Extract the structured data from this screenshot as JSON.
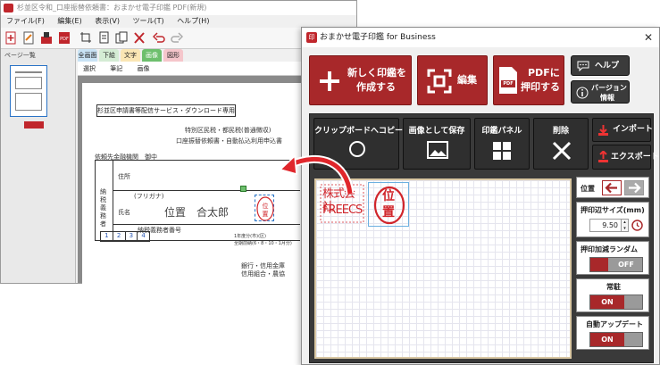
{
  "background_app": {
    "title": "杉並区令和_口座振替依頼書：おまかせ電子印鑑 PDF(新規)",
    "menu": [
      "ファイル(F)",
      "編集(E)",
      "表示(V)",
      "ツール(T)",
      "ヘルプ(H)"
    ],
    "page_panel_title": "ページ一覧",
    "tabs": [
      "全画面",
      "下絵",
      "文字",
      "画像",
      "図形"
    ],
    "subbar": [
      "選択",
      "筆記",
      "画像",
      "図形"
    ],
    "document": {
      "heading": "杉並区申請書等配信サービス・ダウンロード専用",
      "line1": "特別区民税・都民税(普通徴収)",
      "line2": "口座振替依頼書・自動払込利用申込書",
      "payer_label": "依頼先金融機関　御中",
      "address_label": "住所",
      "furigana_label": "(フリガナ)",
      "name_label": "氏名",
      "name_value": "位置　合太郎",
      "taxpayer_number_label": "納税義務者番号",
      "side_label": "納税義務者",
      "boxes": [
        "1",
        "2",
        "3",
        "4"
      ],
      "bank_label": "銀行・信用金庫",
      "bank_label2": "信用組合・農協",
      "small_right1": "1年度分(市)(区)",
      "small_right2": "全期前納(6・8・10・1月分)"
    }
  },
  "window": {
    "title": "おまかせ電子印鑑 for Business",
    "title_icon": "印",
    "buttons": {
      "new_stamp": [
        "新しく印鑑を",
        "作成する"
      ],
      "edit": "編集",
      "pdf_stamp": [
        "PDFに",
        "押印する"
      ],
      "pdf_icon_text": "PDF",
      "help": "ヘルプ",
      "version": [
        "バージョン",
        "情報"
      ],
      "clipboard_copy": "クリップボードへコピー",
      "save_image": "画像として保存",
      "stamp_panel": "印鑑パネル",
      "delete": "削除",
      "import": "インポート",
      "export": "エクスポート"
    },
    "stamps": {
      "company_stamp": [
        "株式会社",
        "FREECS"
      ],
      "round_stamp": [
        "位",
        "置"
      ]
    },
    "side_panel": {
      "position_label": "位置",
      "size_label": "押印辺サイズ(mm)",
      "size_value": "9.50",
      "random_label": "押印加減ランダム",
      "random_state": "OFF",
      "always_on_top_label": "常駐",
      "always_on_top_state": "ON",
      "auto_update_label": "自動アップデート",
      "auto_update_state": "ON"
    },
    "colors": {
      "brand_red": "#a8282a",
      "dark": "#2f2f2f",
      "stamp_red": "#d0252b"
    }
  }
}
